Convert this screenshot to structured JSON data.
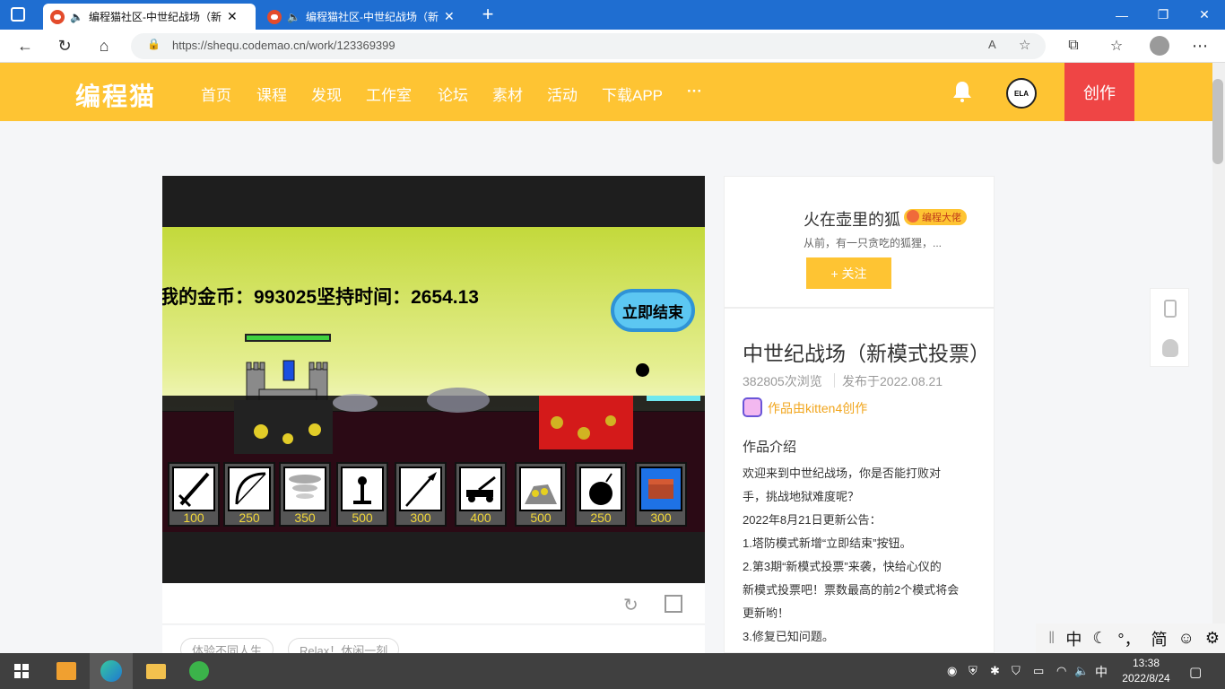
{
  "browser": {
    "tabs": [
      {
        "title": "编程猫社区-中世纪战场（新",
        "close": "✕"
      },
      {
        "title": "编程猫社区-中世纪战场（新",
        "close": "✕"
      }
    ],
    "new_tab": "+",
    "url": "https://shequ.codemao.cn/work/123369399",
    "window_controls": {
      "minimize": "—",
      "restore": "❐",
      "close": "✕"
    }
  },
  "site": {
    "logo": "编程猫",
    "nav": [
      "首页",
      "课程",
      "发现",
      "工作室",
      "论坛",
      "素材",
      "活动",
      "下载APP",
      "···"
    ],
    "avatar_text": "ELA",
    "create_label": "创作"
  },
  "game": {
    "hud": "我的金币：99302​5坚持时间：2654.13",
    "end_button": "立即结束",
    "units": [
      {
        "cost": "100",
        "icon": "sword-icon"
      },
      {
        "cost": "250",
        "icon": "bow-icon"
      },
      {
        "cost": "350",
        "icon": "tornado-icon"
      },
      {
        "cost": "500",
        "icon": "tesla-icon"
      },
      {
        "cost": "300",
        "icon": "spear-icon"
      },
      {
        "cost": "400",
        "icon": "catapult-icon"
      },
      {
        "cost": "500",
        "icon": "gold-mine-icon"
      },
      {
        "cost": "250",
        "icon": "bomb-icon"
      },
      {
        "cost": "300",
        "icon": "treasure-icon"
      }
    ],
    "tags": [
      "体验不同人生",
      "Relax！休闲一刻"
    ]
  },
  "author": {
    "name": "火在壶里的狐",
    "badge": "编程大佬",
    "bio": "从前，有一只贪吃的狐狸，...",
    "follow_label": "+ 关注"
  },
  "work": {
    "title": "中世纪战场（新模式投票）",
    "views": "382805次浏览",
    "published": "发布于2022.08.21",
    "creator": "作品由kitten4创作",
    "intro_label": "作品介绍",
    "intro_lines": [
      "欢迎来到中世纪战场，你是否能打败对",
      "手，挑战地狱难度呢？",
      "2022年8月21日更新公告：",
      "1.塔防模式新增“立即结束”按钮。",
      "2.第3期“新模式投票”来袭，快给心仪的",
      "新模式投票吧！票数最高的前2个模式将会",
      "更新哟！",
      "3.修复已知问题。"
    ]
  },
  "ime": {
    "lang": "中",
    "punct": "°，",
    "simplified": "简"
  },
  "taskbar": {
    "tray_lang": "中",
    "time": "13:38",
    "date": "2022/8/24"
  },
  "colors": {
    "brand_yellow": "#fec433",
    "create_red": "#ef4545",
    "titlebar_blue": "#1f6ed1",
    "taskbar": "#404040"
  }
}
